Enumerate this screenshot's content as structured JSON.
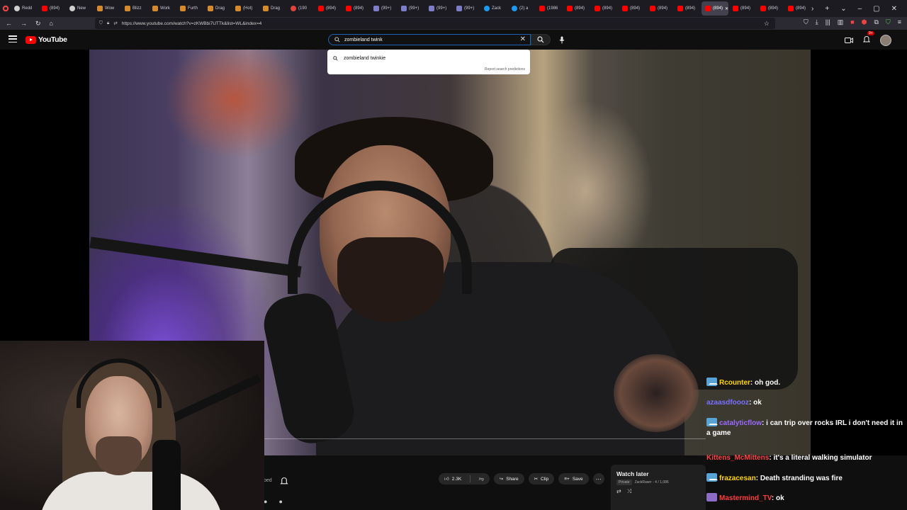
{
  "browser": {
    "tabs": [
      {
        "label": "Redd",
        "icon": "reddit-favicon",
        "kind": "gh"
      },
      {
        "label": "(894)",
        "icon": "youtube-favicon",
        "kind": "yt"
      },
      {
        "label": "New",
        "icon": "generic-favicon",
        "kind": "gh"
      },
      {
        "label": "Wow",
        "icon": "tool-favicon",
        "kind": "tool"
      },
      {
        "label": "Blizz",
        "icon": "tool-favicon",
        "kind": "tool"
      },
      {
        "label": "Work",
        "icon": "tool-favicon",
        "kind": "tool"
      },
      {
        "label": "Furth",
        "icon": "tool-favicon",
        "kind": "tool"
      },
      {
        "label": "Drag",
        "icon": "tool-favicon",
        "kind": "tool"
      },
      {
        "label": "(Hot)",
        "icon": "tool-favicon",
        "kind": "tool"
      },
      {
        "label": "Drag",
        "icon": "tool-favicon",
        "kind": "tool"
      },
      {
        "label": "(190",
        "icon": "red-favicon",
        "kind": "red"
      },
      {
        "label": "(894)",
        "icon": "youtube-favicon",
        "kind": "yt"
      },
      {
        "label": "(894)",
        "icon": "youtube-favicon",
        "kind": "yt"
      },
      {
        "label": "(99+)",
        "icon": "square-favicon",
        "kind": "sq"
      },
      {
        "label": "(99+)",
        "icon": "square-favicon",
        "kind": "sq"
      },
      {
        "label": "(99+)",
        "icon": "square-favicon",
        "kind": "sq"
      },
      {
        "label": "(99+)",
        "icon": "square-favicon",
        "kind": "sq"
      },
      {
        "label": "Zack",
        "icon": "twitter-favicon",
        "kind": "tw"
      },
      {
        "label": "(2) a",
        "icon": "twitter-favicon",
        "kind": "tw"
      },
      {
        "label": "(1986",
        "icon": "youtube-favicon",
        "kind": "yt"
      },
      {
        "label": "(894)",
        "icon": "youtube-favicon",
        "kind": "yt"
      },
      {
        "label": "(894)",
        "icon": "youtube-favicon",
        "kind": "yt"
      },
      {
        "label": "(894)",
        "icon": "youtube-favicon",
        "kind": "yt"
      },
      {
        "label": "(894)",
        "icon": "youtube-favicon",
        "kind": "yt"
      },
      {
        "label": "(894)",
        "icon": "youtube-favicon",
        "kind": "yt"
      },
      {
        "label": "(894)",
        "icon": "youtube-favicon",
        "kind": "yt",
        "active": true
      },
      {
        "label": "(894)",
        "icon": "youtube-favicon",
        "kind": "yt"
      },
      {
        "label": "(894)",
        "icon": "youtube-favicon",
        "kind": "yt"
      },
      {
        "label": "(894)",
        "icon": "youtube-favicon",
        "kind": "yt"
      }
    ],
    "url": "https://www.youtube.com/watch?v=zKWBbi7UTTk&list=WL&index=4"
  },
  "youtube": {
    "logo_text": "YouTube",
    "search_value": "zombieland twink",
    "suggestion": "zombieland twinkie",
    "report_link": "Report search predictions",
    "notification_count": "9+"
  },
  "video": {
    "subscribe_fragment": "bed",
    "like_count": "2.3K",
    "share_label": "Share",
    "clip_label": "Clip",
    "save_label": "Save"
  },
  "playlist": {
    "title": "Watch later",
    "privacy": "Private",
    "meta": "ZackRawrr - 4 / 1,086"
  },
  "chat": {
    "messages": [
      {
        "user": "Rcounter",
        "user_color": "#ffd700",
        "text": "oh god.",
        "badge": "prime"
      },
      {
        "user": "azaasdfoooz",
        "user_color": "#7a6fff",
        "text": "ok",
        "badge": ""
      },
      {
        "user": "catalyticflow",
        "user_color": "#9b6bff",
        "text": "i can trip over rocks IRL i don't need it in a game",
        "badge": "prime"
      },
      {
        "user": "Kittens_McMittens",
        "user_color": "#ff4444",
        "text": "it's a literal walking simulator",
        "badge": ""
      },
      {
        "user": "frazacesan",
        "user_color": "#ffd700",
        "text": "Death stranding was fire",
        "badge": "prime"
      },
      {
        "user": "Mastermind_TV",
        "user_color": "#ff3c3c",
        "text": "ok",
        "badge": "avatar"
      }
    ]
  }
}
